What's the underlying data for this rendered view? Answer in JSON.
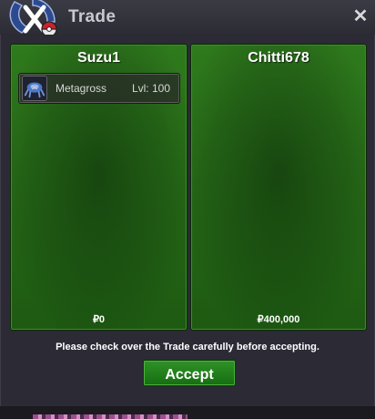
{
  "window": {
    "title": "Trade",
    "close_icon": "close-icon",
    "logo_icon": "pokeball-logo-icon"
  },
  "left_panel": {
    "player_name": "Suzu1",
    "items": [
      {
        "pokemon": "Metagross",
        "level": "Lvl: 100",
        "icon": "metagross-sprite-icon"
      }
    ],
    "money": "₽0"
  },
  "right_panel": {
    "player_name": "Chitti678",
    "items": [],
    "money": "₽400,000"
  },
  "footer": {
    "notice": "Please check over the Trade carefully before accepting.",
    "accept_label": "Accept"
  },
  "colors": {
    "panel_green": "#2f7a1d",
    "button_green": "#2f9227",
    "window_bg": "#2b2a35"
  }
}
